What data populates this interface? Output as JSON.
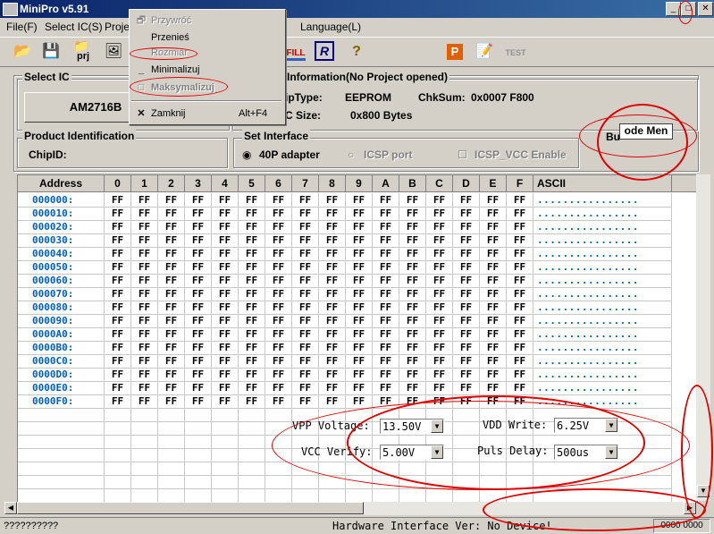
{
  "window": {
    "title": "MiniPro v5.91"
  },
  "menubar": {
    "file": "File(F)",
    "select_ic": "Select IC(S)",
    "project": "Proje",
    "language": "Language(L)"
  },
  "toolbar": {
    "prj_label": "prj",
    "fill_label": "FILL",
    "test_label": "TEST"
  },
  "select_ic": {
    "title": "Select IC",
    "button": "AM2716B"
  },
  "info": {
    "title": "Information(No Project opened)",
    "chiptype_label": "ipType:",
    "chiptype_value": "EEPROM",
    "chksum_label": "ChkSum:",
    "chksum_value": "0x0007 F800",
    "size_label": "C Size:",
    "size_value": "0x800 Bytes",
    "bu_label": "Bu",
    "bu_box": "ode Men"
  },
  "product": {
    "title": "Product Identification",
    "chipid": "ChipID:"
  },
  "interface": {
    "title": "Set Interface",
    "opt1": "40P adapter",
    "opt2": "ICSP port",
    "opt3": "ICSP_VCC Enable"
  },
  "grid": {
    "headers": [
      "Address",
      "0",
      "1",
      "2",
      "3",
      "4",
      "5",
      "6",
      "7",
      "8",
      "9",
      "A",
      "B",
      "C",
      "D",
      "E",
      "F",
      "ASCII"
    ],
    "addresses": [
      "000000:",
      "000010:",
      "000020:",
      "000030:",
      "000040:",
      "000050:",
      "000060:",
      "000070:",
      "000080:",
      "000090:",
      "0000A0:",
      "0000B0:",
      "0000C0:",
      "0000D0:",
      "0000E0:",
      "0000F0:"
    ],
    "cell_value": "FF",
    "ascii_value": "................"
  },
  "settings": {
    "vpp_label": "VPP Voltage:",
    "vpp_value": "13.50V",
    "vdd_label": "VDD Write:",
    "vdd_value": "6.25V",
    "vcc_label": "VCC Verify:",
    "vcc_value": "5.00V",
    "puls_label": "Puls Delay:",
    "puls_value": "500us"
  },
  "sysmenu": {
    "restore": "Przywróć",
    "move": "Przenieś",
    "size": "Rozmiar",
    "minimize": "Minimalizuj",
    "maximize": "Maksymalizuj",
    "close": "Zamknij",
    "close_shortcut": "Alt+F4"
  },
  "status": {
    "left": "??????????",
    "center": "Hardware Interface Ver: No Device!",
    "right": "0000 0000"
  },
  "colors": {
    "accent": "#0a246a",
    "address_blue": "#0060c0",
    "annotation_red": "#e00000"
  }
}
